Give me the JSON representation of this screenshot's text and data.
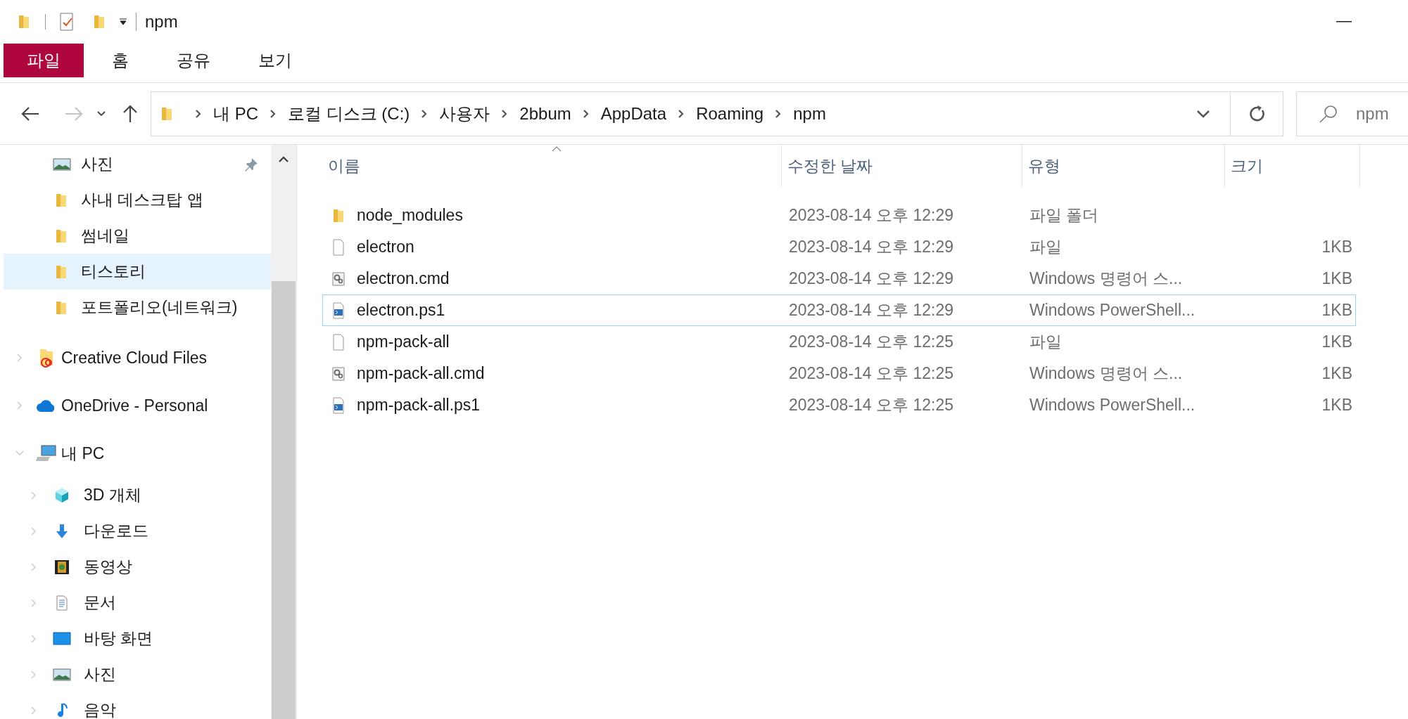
{
  "window": {
    "title": "npm"
  },
  "ribbon_tabs": [
    {
      "label": "파일",
      "selected": true
    },
    {
      "label": "홈",
      "selected": false
    },
    {
      "label": "공유",
      "selected": false
    },
    {
      "label": "보기",
      "selected": false
    }
  ],
  "address_bar": {
    "path": [
      "내 PC",
      "로컬 디스크 (C:)",
      "사용자",
      "2bbum",
      "AppData",
      "Roaming",
      "npm"
    ]
  },
  "search": {
    "placeholder": "npm"
  },
  "sidebar": {
    "quick_access": [
      {
        "label": "사진",
        "kind": "photos",
        "pinned": true,
        "selected": false
      },
      {
        "label": "사내 데스크탑 앱",
        "kind": "folder",
        "pinned": false,
        "selected": false
      },
      {
        "label": "썸네일",
        "kind": "folder",
        "pinned": false,
        "selected": false
      },
      {
        "label": "티스토리",
        "kind": "folder",
        "pinned": false,
        "selected": true
      },
      {
        "label": "포트폴리오(네트워크)",
        "kind": "folder",
        "pinned": false,
        "selected": false
      }
    ],
    "tree": [
      {
        "label": "Creative Cloud Files",
        "kind": "cloud-folder",
        "expanded": false
      },
      {
        "label": "OneDrive - Personal",
        "kind": "onedrive",
        "expanded": false
      },
      {
        "label": "내 PC",
        "kind": "pc",
        "expanded": true,
        "children": [
          {
            "label": "3D 개체",
            "kind": "cube",
            "expanded": false
          },
          {
            "label": "다운로드",
            "kind": "download",
            "expanded": false
          },
          {
            "label": "동영상",
            "kind": "video",
            "expanded": false
          },
          {
            "label": "문서",
            "kind": "document",
            "expanded": false
          },
          {
            "label": "바탕 화면",
            "kind": "desktop",
            "expanded": false
          },
          {
            "label": "사진",
            "kind": "photos",
            "expanded": false
          },
          {
            "label": "음악",
            "kind": "music",
            "expanded": false
          }
        ]
      }
    ]
  },
  "table": {
    "columns": [
      {
        "label": "이름",
        "sorted": true
      },
      {
        "label": "수정한 날짜",
        "sorted": false
      },
      {
        "label": "유형",
        "sorted": false
      },
      {
        "label": "크기",
        "sorted": false
      }
    ],
    "rows": [
      {
        "name": "node_modules",
        "kind": "folder",
        "modified": "2023-08-14 오후 12:29",
        "type": "파일 폴더",
        "focused": false
      },
      {
        "name": "electron",
        "kind": "file",
        "modified": "2023-08-14 오후 12:29",
        "type": "파일",
        "size": "1KB",
        "focused": false
      },
      {
        "name": "electron.cmd",
        "kind": "cmd",
        "modified": "2023-08-14 오후 12:29",
        "type": "Windows 명령어 스...",
        "size": "1KB",
        "focused": false
      },
      {
        "name": "electron.ps1",
        "kind": "ps1",
        "modified": "2023-08-14 오후 12:29",
        "type": "Windows PowerShell...",
        "size": "1KB",
        "focused": true
      },
      {
        "name": "npm-pack-all",
        "kind": "file",
        "modified": "2023-08-14 오후 12:25",
        "type": "파일",
        "size": "1KB",
        "focused": false
      },
      {
        "name": "npm-pack-all.cmd",
        "kind": "cmd",
        "modified": "2023-08-14 오후 12:25",
        "type": "Windows 명령어 스...",
        "size": "1KB",
        "focused": false
      },
      {
        "name": "npm-pack-all.ps1",
        "kind": "ps1",
        "modified": "2023-08-14 오후 12:25",
        "type": "Windows PowerShell...",
        "size": "1KB",
        "focused": false
      }
    ]
  }
}
